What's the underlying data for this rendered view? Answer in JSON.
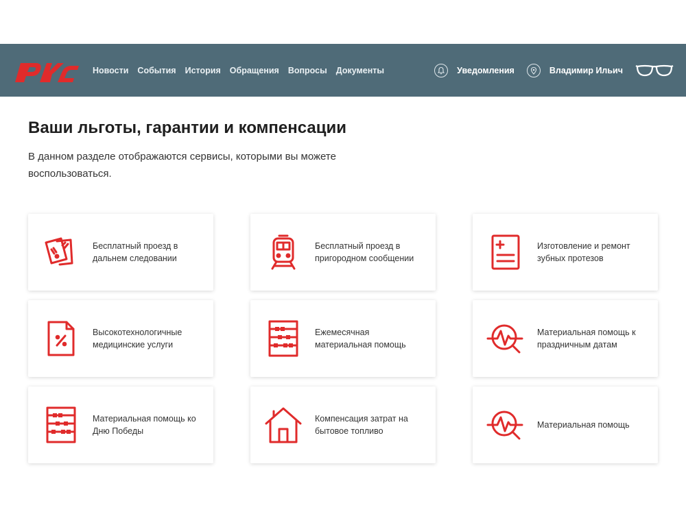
{
  "header": {
    "nav": [
      "Новости",
      "События",
      "История",
      "Обращения",
      "Вопросы",
      "Документы"
    ],
    "notifications_label": "Уведомления",
    "user_name": "Владимир Ильич"
  },
  "colors": {
    "header_bg": "#4f6b78",
    "accent": "#e02b2b"
  },
  "page": {
    "title": "Ваши льготы, гарантии и компенсации",
    "description": "В данном разделе отображаются сервисы, которыми вы можете воспользоваться."
  },
  "cards": [
    {
      "icon": "tickets-icon",
      "title": "Бесплатный проезд в дальнем следовании"
    },
    {
      "icon": "train-icon",
      "title": "Бесплатный проезд в пригородном сообщении"
    },
    {
      "icon": "medical-document-icon",
      "title": "Изготовление и ремонт зубных протезов"
    },
    {
      "icon": "percent-document-icon",
      "title": "Высокотехнологичные медицинские услуги"
    },
    {
      "icon": "abacus-icon",
      "title": "Ежемесячная материальная помощь"
    },
    {
      "icon": "pulse-search-icon",
      "title": "Материальная помощь к праздничным датам"
    },
    {
      "icon": "abacus-icon",
      "title": "Материальная помощь ко Дню Победы"
    },
    {
      "icon": "house-icon",
      "title": "Компенсация затрат на бытовое топливо"
    },
    {
      "icon": "pulse-search-icon",
      "title": "Материальная помощь"
    }
  ]
}
